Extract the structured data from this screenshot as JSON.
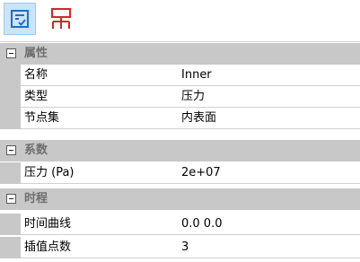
{
  "toolbar": {
    "buttons": [
      {
        "icon": "checklist-icon",
        "active": true,
        "color": "#1e6fc5"
      },
      {
        "icon": "tree-structure-icon",
        "active": false,
        "color": "#d8232a"
      }
    ]
  },
  "grid": {
    "categories": [
      {
        "label": "属性",
        "rows": [
          {
            "name": "名称",
            "value": "Inner"
          },
          {
            "name": "类型",
            "value": "压力"
          },
          {
            "name": "节点集",
            "value": "内表面"
          }
        ]
      },
      {
        "label": "系数",
        "rows": [
          {
            "name": "压力 (Pa)",
            "value": "2e+07"
          }
        ]
      },
      {
        "label": "时程",
        "rows": [
          {
            "name": "时间曲线",
            "value": "0.0 0.0"
          },
          {
            "name": "插值点数",
            "value": "3"
          }
        ]
      }
    ]
  }
}
